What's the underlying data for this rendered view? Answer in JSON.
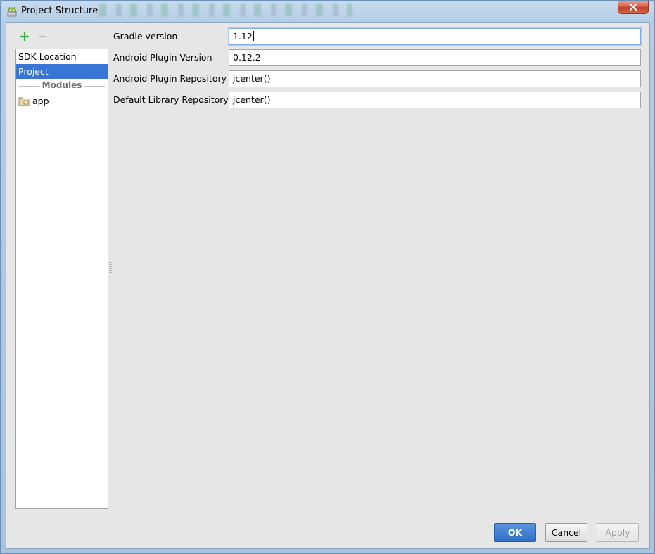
{
  "window": {
    "title": "Project Structure"
  },
  "toolbar": {
    "add_icon": "plus-icon",
    "remove_icon": "minus-icon"
  },
  "sidebar": {
    "items": [
      {
        "label": "SDK Location",
        "selected": false
      },
      {
        "label": "Project",
        "selected": true
      }
    ],
    "modules_header": "Modules",
    "modules": [
      {
        "label": "app",
        "icon": "module-folder-icon"
      }
    ]
  },
  "form": {
    "fields": [
      {
        "label": "Gradle version",
        "value": "1.12"
      },
      {
        "label": "Android Plugin Version",
        "value": "0.12.2"
      },
      {
        "label": "Android Plugin Repository",
        "value": "jcenter()"
      },
      {
        "label": "Default Library Repository",
        "value": "jcenter()"
      }
    ]
  },
  "buttons": {
    "ok": "OK",
    "cancel": "Cancel",
    "apply": "Apply"
  },
  "colors": {
    "selection": "#3875d7",
    "ok_button": "#3a78cc",
    "add_icon": "#3fa83f"
  }
}
